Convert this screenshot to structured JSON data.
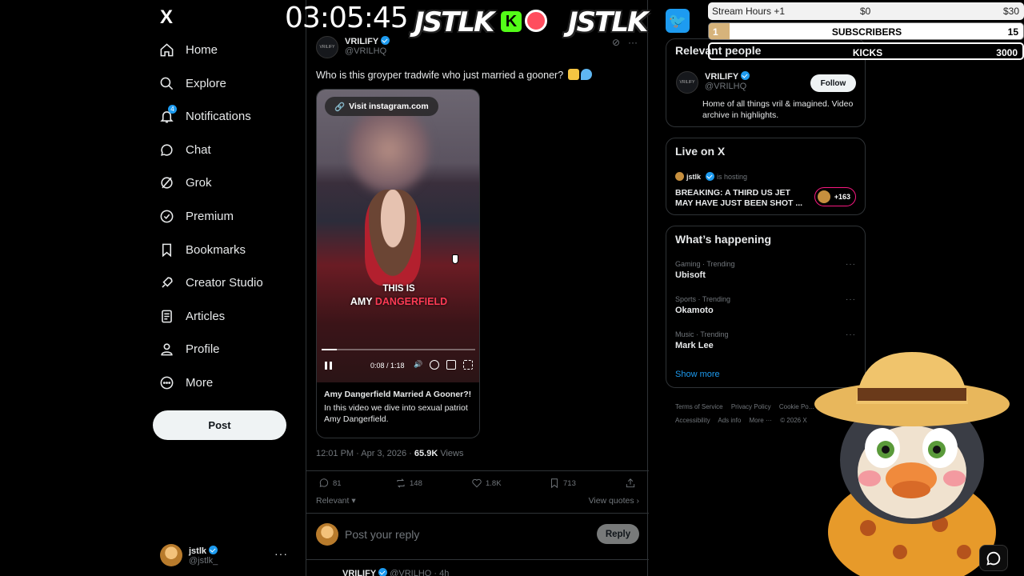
{
  "overlay": {
    "clock": "03:05:45",
    "logo_left": "JSTLK",
    "logo_right": "JSTLK",
    "kick_glyph": "K",
    "twitter_glyph": "🐦",
    "stats": {
      "row1": {
        "label": "Stream Hours +1",
        "mid": "$0",
        "right": "$30"
      },
      "row2": {
        "left": "1",
        "label": "SUBSCRIBERS",
        "right": "15"
      },
      "row3": {
        "label": "KICKS",
        "right": "3000"
      }
    }
  },
  "nav": {
    "logo": "X",
    "items": [
      {
        "label": "Home",
        "icon": "home-icon"
      },
      {
        "label": "Explore",
        "icon": "search-icon"
      },
      {
        "label": "Notifications",
        "icon": "bell-icon",
        "badge": "4"
      },
      {
        "label": "Chat",
        "icon": "chat-icon"
      },
      {
        "label": "Grok",
        "icon": "grok-icon"
      },
      {
        "label": "Premium",
        "icon": "premium-icon"
      },
      {
        "label": "Bookmarks",
        "icon": "bookmark-icon"
      },
      {
        "label": "Creator Studio",
        "icon": "rocket-icon"
      },
      {
        "label": "Articles",
        "icon": "articles-icon"
      },
      {
        "label": "Profile",
        "icon": "person-icon"
      },
      {
        "label": "More",
        "icon": "more-circle-icon"
      }
    ],
    "post_label": "Post",
    "account": {
      "name": "jstlk",
      "handle": "@jstlk_",
      "more": "···"
    }
  },
  "post": {
    "author_name": "VRILIFY",
    "author_handle": "@VRILHQ",
    "avatar_text": "VRILIFY",
    "text": "Who is this groyper tradwife who just married a gooner?",
    "video": {
      "link_label": "Visit instagram.com",
      "caption_line1": "THIS IS",
      "caption_line2_white": "AMY ",
      "caption_line2_red": "DANGERFIELD",
      "time": "0:08 / 1:18",
      "progress": 0.1
    },
    "card_title": "Amy Dangerfield Married A Gooner?!",
    "card_desc": "In this video we dive into sexual patriot Amy Dangerfield.",
    "meta_time": "12:01 PM · Apr 3, 2026 · ",
    "meta_views": "65.9K",
    "meta_views_label": " Views",
    "actions": {
      "replies": "81",
      "reposts": "148",
      "likes": "1.8K",
      "bookmarks": "713"
    },
    "sort_label": "Relevant",
    "view_quotes": "View quotes ›",
    "reply_placeholder": "Post your reply",
    "reply_button": "Reply",
    "next_author": "VRILIFY",
    "next_meta": "@VRILHQ · 4h"
  },
  "right": {
    "relevant_title": "Relevant people",
    "relevant_user": {
      "name": "VRILIFY",
      "handle": "@VRILHQ",
      "follow": "Follow",
      "bio": "Home of all things vril & imagined. Video archive in highlights."
    },
    "live_title": "Live on X",
    "live_host_name": "jstlk",
    "live_host_suffix": "is hosting",
    "live_headline": "BREAKING: A THIRD US JET MAY HAVE JUST BEEN SHOT ...",
    "live_count": "+163",
    "happening_title": "What’s happening",
    "trends": [
      {
        "category": "Gaming · Trending",
        "name": "Ubisoft"
      },
      {
        "category": "Sports · Trending",
        "name": "Okamoto"
      },
      {
        "category": "Music · Trending",
        "name": "Mark Lee"
      }
    ],
    "show_more": "Show more",
    "footer": [
      "Terms of Service",
      "Privacy Policy",
      "Cookie Po...",
      "Accessibility",
      "Ads info",
      "More ···",
      "© 2026 X"
    ]
  },
  "colors": {
    "accent": "#1d9bf0",
    "kick": "#53fc18",
    "live": "#f91880"
  }
}
